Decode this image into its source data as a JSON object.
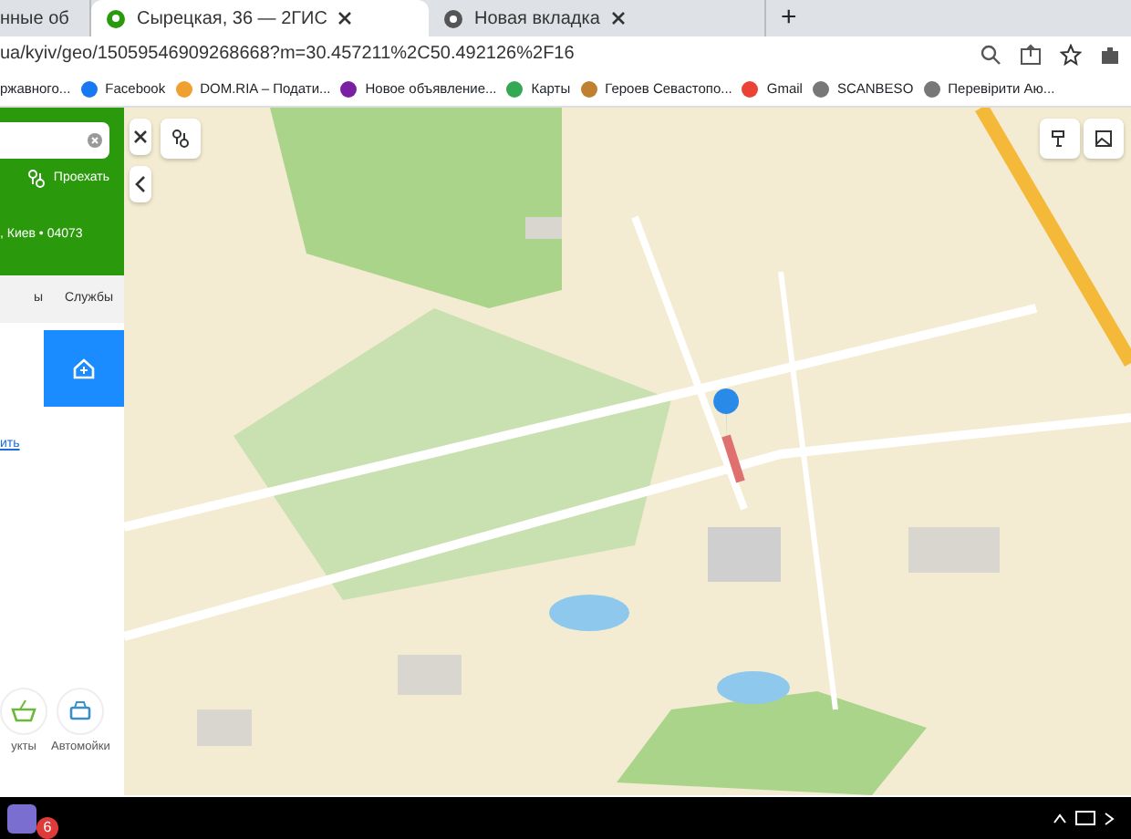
{
  "browser": {
    "tabs": [
      {
        "title": "нные об",
        "selected": false
      },
      {
        "title": "Сырецкая, 36 — 2ГИС",
        "selected": true
      },
      {
        "title": "Новая вкладка",
        "selected": false
      }
    ],
    "new_tab": "+",
    "address": "ua/kyiv/geo/15059546909268668?m=30.457211%2C50.492126%2F16",
    "bookmarks": [
      "ржавного...",
      "Facebook",
      "DOM.RIA – Подати...",
      "Новое объявление...",
      "Карты",
      "Героев Севастопо...",
      "Gmail",
      "SCANBESO",
      "Перевірити Аю..."
    ]
  },
  "sidebar": {
    "route_action": "Проехать",
    "address_line": ", Киев • 04073",
    "tabs": [
      {
        "label": "ы",
        "selected": false
      },
      {
        "label": "Службы",
        "selected": false
      }
    ],
    "link": "ить",
    "categories": [
      "укты",
      "Автомойки"
    ]
  },
  "taskbar": {
    "badge": "6"
  }
}
